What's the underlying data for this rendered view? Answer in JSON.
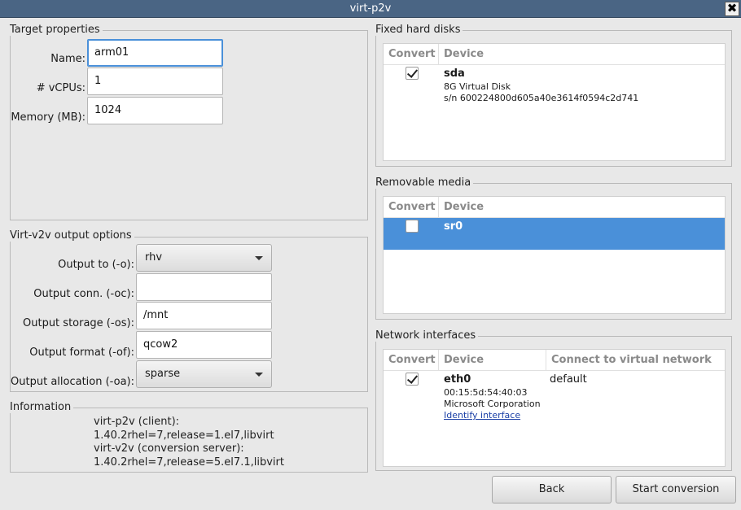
{
  "window": {
    "title": "virt-p2v",
    "close_glyph": "✖"
  },
  "target": {
    "frame_label": "Target properties",
    "name_label": "Name:",
    "name_value": "arm01",
    "vcpus_label": "# vCPUs:",
    "vcpus_value": "1",
    "memory_label": "Memory (MB):",
    "memory_value": "1024"
  },
  "output": {
    "frame_label": "Virt-v2v output options",
    "to_label": "Output to (-o):",
    "to_value": "rhv",
    "conn_label": "Output conn. (-oc):",
    "conn_value": "",
    "storage_label": "Output storage (-os):",
    "storage_value": "/mnt",
    "format_label": "Output format (-of):",
    "format_value": "qcow2",
    "allocation_label": "Output allocation (-oa):",
    "allocation_value": "sparse"
  },
  "info": {
    "frame_label": "Information",
    "lines": [
      "virt-p2v (client):",
      "1.40.2rhel=7,release=1.el7,libvirt",
      "virt-v2v (conversion server):",
      "1.40.2rhel=7,release=5.el7.1,libvirt"
    ]
  },
  "fixed_disks": {
    "frame_label": "Fixed hard disks",
    "col_convert": "Convert",
    "col_device": "Device",
    "rows": [
      {
        "checked": true,
        "name": "sda",
        "size": "8G Virtual Disk",
        "serial": "s/n 600224800d605a40e3614f0594c2d741"
      }
    ]
  },
  "removable": {
    "frame_label": "Removable media",
    "col_convert": "Convert",
    "col_device": "Device",
    "rows": [
      {
        "checked": false,
        "selected": true,
        "name": "sr0"
      }
    ]
  },
  "network": {
    "frame_label": "Network interfaces",
    "col_convert": "Convert",
    "col_device": "Device",
    "col_network": "Connect to virtual network",
    "rows": [
      {
        "checked": true,
        "name": "eth0",
        "mac": "00:15:5d:54:40:03",
        "vendor": "Microsoft Corporation",
        "identify_link": "Identify interface",
        "network": "default"
      }
    ]
  },
  "buttons": {
    "back": "Back",
    "start": "Start conversion"
  },
  "colors": {
    "title_bar": "#4a6584",
    "selection": "#4a90d9",
    "background": "#e8e8e8"
  },
  "icons": {
    "close": "close-icon",
    "dropdown": "chevron-down-icon",
    "checkbox": "checkbox-icon"
  }
}
